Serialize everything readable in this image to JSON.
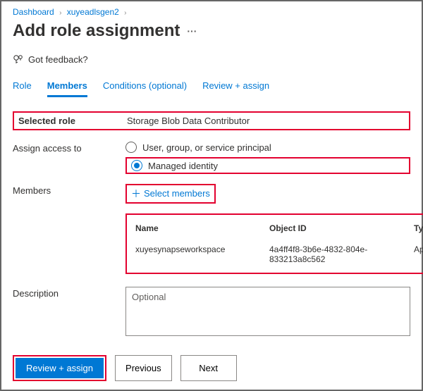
{
  "breadcrumb": {
    "items": [
      "Dashboard",
      "xuyeadlsgen2"
    ]
  },
  "page_title": "Add role assignment",
  "feedback_label": "Got feedback?",
  "tabs": {
    "role": "Role",
    "members": "Members",
    "conditions": "Conditions (optional)",
    "review": "Review + assign"
  },
  "labels": {
    "selected_role": "Selected role",
    "assign_access_to": "Assign access to",
    "members": "Members",
    "description": "Description"
  },
  "selected_role_value": "Storage Blob Data Contributor",
  "assign_access": {
    "opt_user": "User, group, or service principal",
    "opt_mi": "Managed identity"
  },
  "select_members_label": "Select members",
  "members_table": {
    "headers": {
      "name": "Name",
      "oid": "Object ID",
      "type": "Type"
    },
    "rows": [
      {
        "name": "xuyesynapseworkspace",
        "oid": "4a4ff4f8-3b6e-4832-804e-833213a8c562",
        "type": "App"
      }
    ]
  },
  "description_placeholder": "Optional",
  "footer": {
    "review": "Review + assign",
    "previous": "Previous",
    "next": "Next"
  }
}
